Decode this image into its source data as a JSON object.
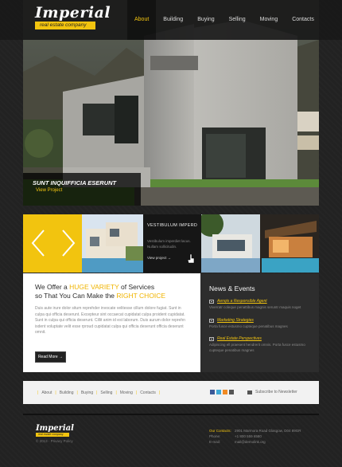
{
  "brand": {
    "name": "Imperial",
    "tagline": "real estate company"
  },
  "nav": [
    {
      "label": "About",
      "active": true
    },
    {
      "label": "Building",
      "active": false
    },
    {
      "label": "Buying",
      "active": false
    },
    {
      "label": "Selling",
      "active": false
    },
    {
      "label": "Moving",
      "active": false
    },
    {
      "label": "Contacts",
      "active": false
    }
  ],
  "hero": {
    "title": "SUNT INQUIFFICIA ESERUNT",
    "link": "View Project"
  },
  "feature": {
    "title": "VESTIBULUM IMPERD",
    "text": "Vestibulum imperdiet lacus. Nullam sollicitudin.",
    "link": "View project →"
  },
  "intro": {
    "line1_pre": "We Offer a ",
    "line1_hl": "HUGE VARIETY",
    "line1_post": " of Services",
    "line2_pre": "so That You Can Make the ",
    "line2_hl": "RIGHT CHOICE",
    "para1": "Duis aute irure dolor situm reprehder invocate velitesse cillum dolore fugiat. Sunt in culpa qui officia deserunt. Excepteur sint occaecat cupidatat culpa proident cupidatat.",
    "para2": "Sunt in culpa qui officia deserunt. Cillit anim id est laborum. Duis aurum dolor reprehn isdent voluptate velit esse rproud cupidatat culpa qui officia deserunt officia deserunt omnit.",
    "read_more": "Read More →"
  },
  "news": {
    "heading": "News & Events",
    "items": [
      {
        "title": "Aenqis a Responsible Agent",
        "text": "Viverratr coleque penattibus magnis seruntr maquis noget"
      },
      {
        "title": "Marketing Strategies",
        "text": "Porta fusce estusmo cupteque penatibus magnes"
      },
      {
        "title": "Real Estate Perspectives",
        "text": "Adipiscing ell praesent hendrerit omnis. Porta fusce estusmo cupteque penatibus magnes"
      }
    ]
  },
  "footer_nav": [
    "About",
    "Building",
    "Buying",
    "Selling",
    "Moving",
    "Contacts"
  ],
  "social_icons": [
    "facebook-icon",
    "twitter-icon",
    "rss-icon",
    "share-icon"
  ],
  "newsletter": "Subscribe to Newsletter",
  "footer": {
    "copyright": "© 2013 · Privacy Policy",
    "contacts_label": "Our Contacts:",
    "address": "2901 Marmora Road Glasgow, D04 89GR",
    "phone_label": "Phone:",
    "phone": "+1 800 559 6580",
    "email_label": "E-mail:",
    "email": "mail@demolink.org"
  },
  "colors": {
    "accent": "#f2c40f",
    "bg": "#232323",
    "panel": "#ffffff",
    "news_bg": "#2d2d2d"
  }
}
